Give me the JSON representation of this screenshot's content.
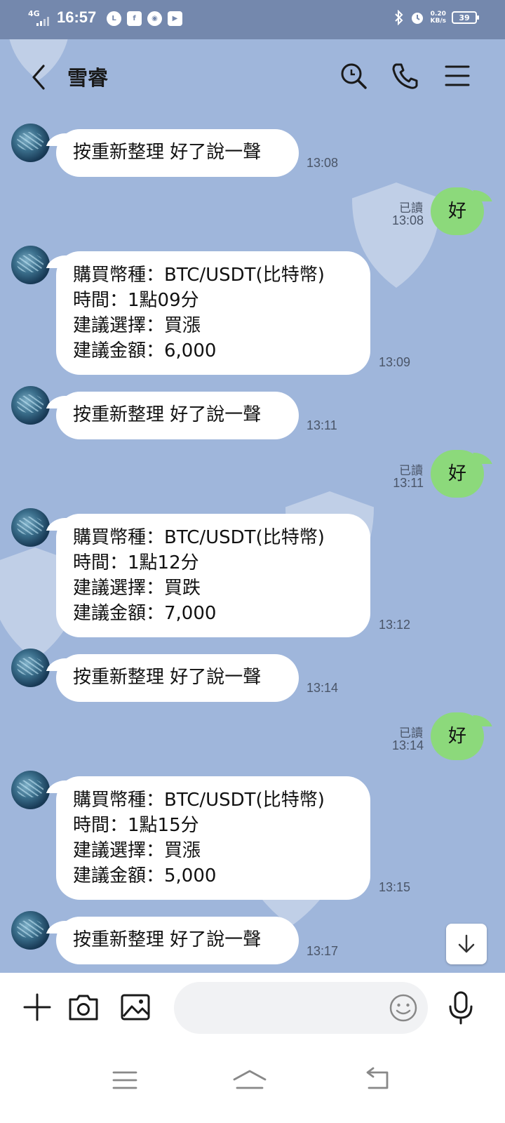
{
  "status_bar": {
    "network": "4G",
    "time": "16:57",
    "app_icons": [
      "line-icon",
      "facebook-icon",
      "chrome-icon",
      "youtube-icon"
    ],
    "speed_value": "0.20",
    "speed_unit": "KB/s",
    "battery": "39",
    "battery_level": 0.39
  },
  "header": {
    "title": "雪睿"
  },
  "messages": [
    {
      "dir": "in",
      "text": "按重新整理 好了說一聲",
      "time": "13:08"
    },
    {
      "dir": "out",
      "text": "好",
      "read": "已讀",
      "time": "13:08"
    },
    {
      "dir": "in",
      "text": "購買幣種：BTC/USDT(比特幣)\n時間：1點09分\n建議選擇：買漲\n建議金額：6,000",
      "time": "13:09"
    },
    {
      "dir": "in",
      "text": "按重新整理 好了說一聲",
      "time": "13:11"
    },
    {
      "dir": "out",
      "text": "好",
      "read": "已讀",
      "time": "13:11"
    },
    {
      "dir": "in",
      "text": "購買幣種：BTC/USDT(比特幣)\n時間：1點12分\n建議選擇：買跌\n建議金額：7,000",
      "time": "13:12"
    },
    {
      "dir": "in",
      "text": "按重新整理 好了說一聲",
      "time": "13:14"
    },
    {
      "dir": "out",
      "text": "好",
      "read": "已讀",
      "time": "13:14"
    },
    {
      "dir": "in",
      "text": "購買幣種：BTC/USDT(比特幣)\n時間：1點15分\n建議選擇：買漲\n建議金額：5,000",
      "time": "13:15"
    },
    {
      "dir": "in",
      "text": "按重新整理 好了說一聲",
      "time": "13:17"
    }
  ],
  "input": {
    "value": "",
    "placeholder": ""
  },
  "colors": {
    "chat_background": "#9fb6db",
    "status_bar": "#7488ad",
    "outgoing_bubble": "#8cd97b",
    "incoming_bubble": "#ffffff"
  }
}
